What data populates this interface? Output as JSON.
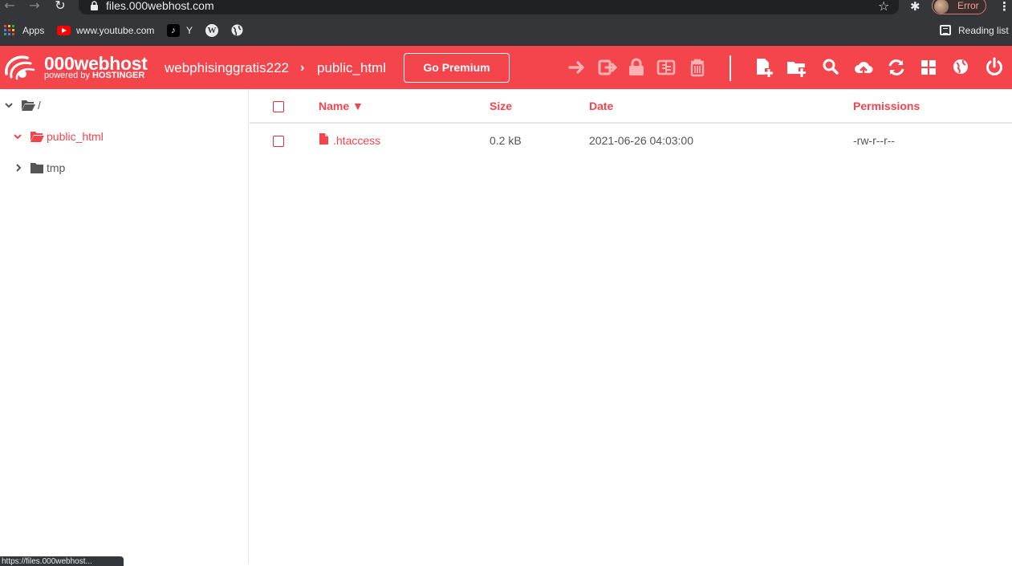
{
  "browser": {
    "url": "files.000webhost.com",
    "profile_label": "Error",
    "bookmarks": {
      "apps": "Apps",
      "youtube": "www.youtube.com",
      "tiktok": "Y",
      "reading_list": "Reading list"
    },
    "status_url": "https://files.000webhost..."
  },
  "header": {
    "brand_name": "000webhost",
    "brand_sub_prefix": "powered by ",
    "brand_sub_strong": "HOSTINGER",
    "breadcrumb_root": "webphisinggratis222",
    "breadcrumb_separator": "›",
    "breadcrumb_current": "public_html",
    "premium_label": "Go Premium",
    "accent": "#f5454c"
  },
  "sidebar": {
    "tree": [
      {
        "label": "/",
        "expanded": true,
        "active": false
      },
      {
        "label": "public_html",
        "expanded": true,
        "active": true
      },
      {
        "label": "tmp",
        "expanded": false,
        "active": false
      }
    ]
  },
  "table": {
    "columns": {
      "name": "Name ▼",
      "size": "Size",
      "date": "Date",
      "permissions": "Permissions"
    },
    "rows": [
      {
        "name": ".htaccess",
        "size": "0.2 kB",
        "date": "2021-06-26 04:03:00",
        "permissions": "-rw-r--r--"
      }
    ]
  }
}
